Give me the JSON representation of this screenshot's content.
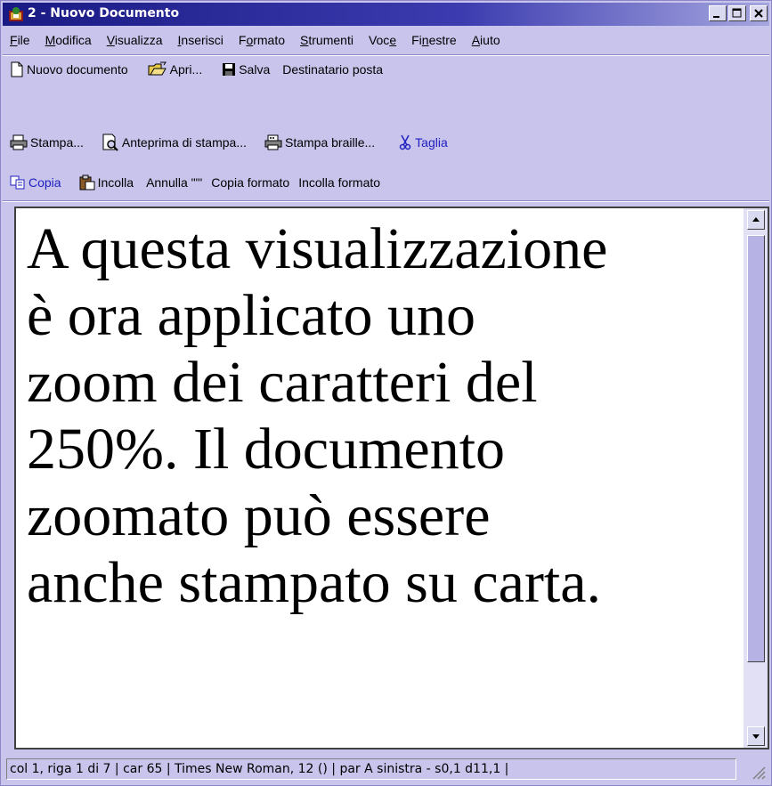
{
  "window": {
    "title": "2 - Nuovo Documento"
  },
  "menubar": {
    "items": [
      {
        "pre": "",
        "u": "F",
        "post": "ile"
      },
      {
        "pre": "",
        "u": "M",
        "post": "odifica"
      },
      {
        "pre": "",
        "u": "V",
        "post": "isualizza"
      },
      {
        "pre": "",
        "u": "I",
        "post": "nserisci"
      },
      {
        "pre": "F",
        "u": "o",
        "post": "rmato"
      },
      {
        "pre": "",
        "u": "S",
        "post": "trumenti"
      },
      {
        "pre": "Voc",
        "u": "e",
        "post": ""
      },
      {
        "pre": "Fi",
        "u": "n",
        "post": "estre"
      },
      {
        "pre": "",
        "u": "A",
        "post": "iuto"
      }
    ]
  },
  "toolbar": {
    "new_doc": "Nuovo documento",
    "open": "Apri...",
    "save": "Salva",
    "mail_recipient": "Destinatario posta",
    "print": "Stampa...",
    "print_preview": "Anteprima di stampa...",
    "braille_print": "Stampa braille...",
    "cut": "Taglia",
    "copy": "Copia",
    "paste": "Incolla",
    "undo": "Annulla \"\"'",
    "copy_format": "Copia formato",
    "paste_format": "Incolla formato"
  },
  "document": {
    "lines": [
      "A questa visualizzazione",
      "è ora applicato uno",
      "zoom dei caratteri del",
      "250%. Il documento",
      "zoomato può essere",
      "anche stampato su carta."
    ]
  },
  "statusbar": {
    "text": "col 1, riga 1 di 7 | car 65 | Times New Roman, 12 () | par A sinistra - s0,1 d11,1 |"
  },
  "colors": {
    "accent": "#1a1a84",
    "chrome": "#c8c4ec",
    "scroll_thumb": "#b6b2e4"
  }
}
